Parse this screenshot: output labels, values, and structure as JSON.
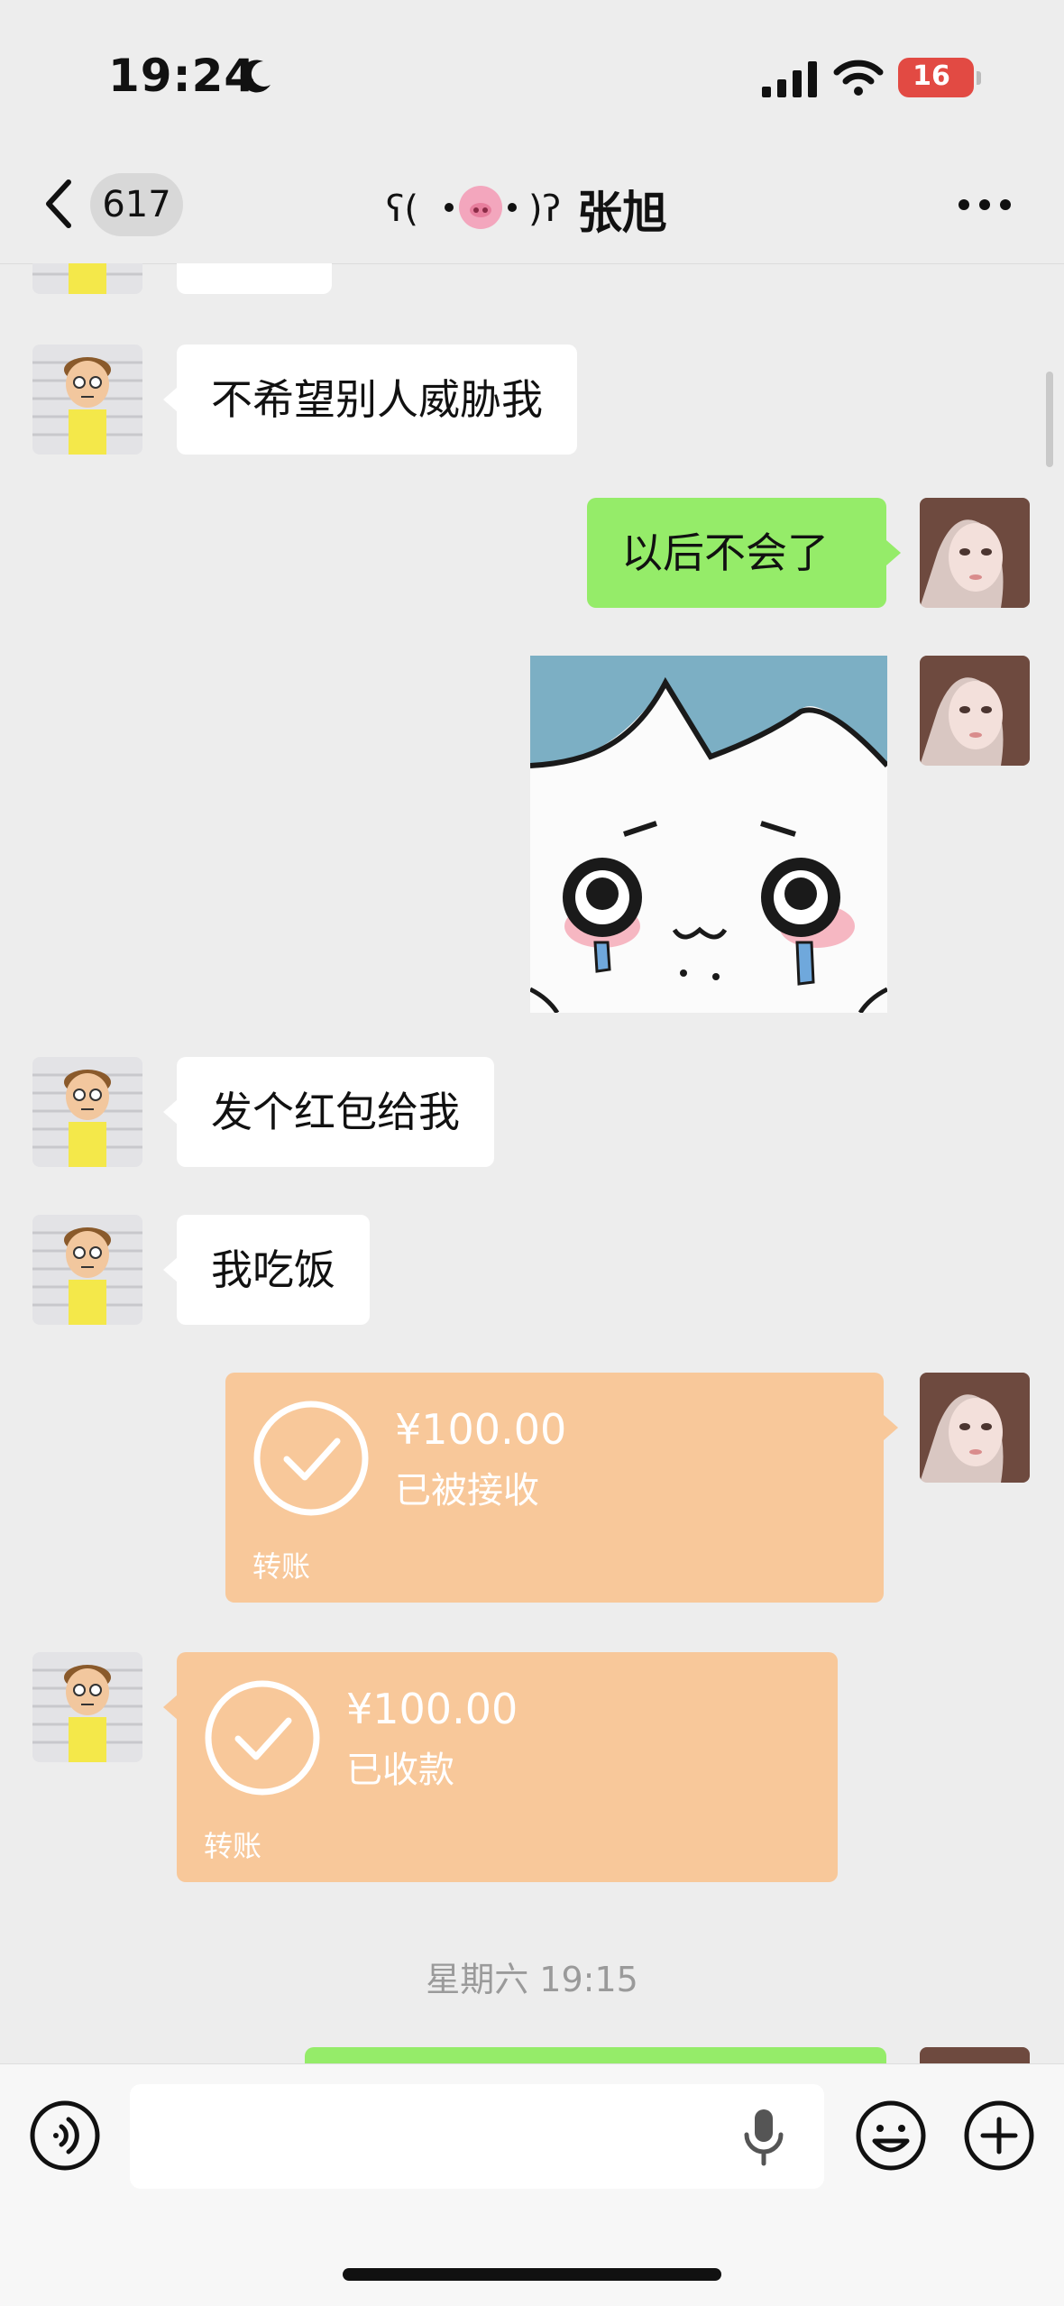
{
  "status_bar": {
    "time": "19:24",
    "battery": "16"
  },
  "nav": {
    "back_count": "617",
    "title_decoration": "ʕ(•̮•)ʔ",
    "title_name": "张旭"
  },
  "messages": {
    "m1": "不希望别人威胁我",
    "m2": "以后不会了",
    "m3": "发个红包给我",
    "m4": "我吃饭"
  },
  "transfers": {
    "sent": {
      "amount": "¥100.00",
      "status": "已被接收",
      "label": "转账"
    },
    "received": {
      "amount": "¥100.00",
      "status": "已收款",
      "label": "转账"
    }
  },
  "timestamp": "星期六 19:15",
  "input": {
    "placeholder": ""
  },
  "colors": {
    "background": "#ededed",
    "bubble_self": "#95ec69",
    "bubble_other": "#ffffff",
    "transfer": "#f8c89a"
  },
  "icons": [
    "moon-icon",
    "signal-icon",
    "wifi-icon",
    "battery-icon",
    "back-icon",
    "more-icon",
    "voice-icon",
    "mic-icon",
    "emoji-icon",
    "plus-icon"
  ]
}
